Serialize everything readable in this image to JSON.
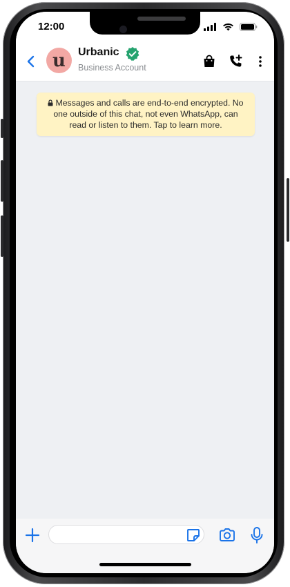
{
  "status_bar": {
    "time": "12:00"
  },
  "header": {
    "contact_name": "Urbanic",
    "subtitle": "Business Account",
    "avatar_letter": "u",
    "avatar_color": "#f2a8a4",
    "verified_color": "#25a36f",
    "accent_color": "#1a73e8"
  },
  "encryption_notice": {
    "text": "Messages and calls are end-to-end encrypted. No one outside of this chat, not even WhatsApp, can read or listen to them. Tap to learn more.",
    "background": "#fff3c4"
  },
  "composer": {
    "message_value": "",
    "placeholder": ""
  },
  "icons": {
    "back": "back-icon",
    "verified": "verified-badge-icon",
    "catalog": "shopping-bag-icon",
    "call": "add-call-icon",
    "menu": "more-vertical-icon",
    "attach": "plus-icon",
    "sticker": "sticker-icon",
    "camera": "camera-icon",
    "mic": "microphone-icon",
    "lock": "lock-icon"
  }
}
